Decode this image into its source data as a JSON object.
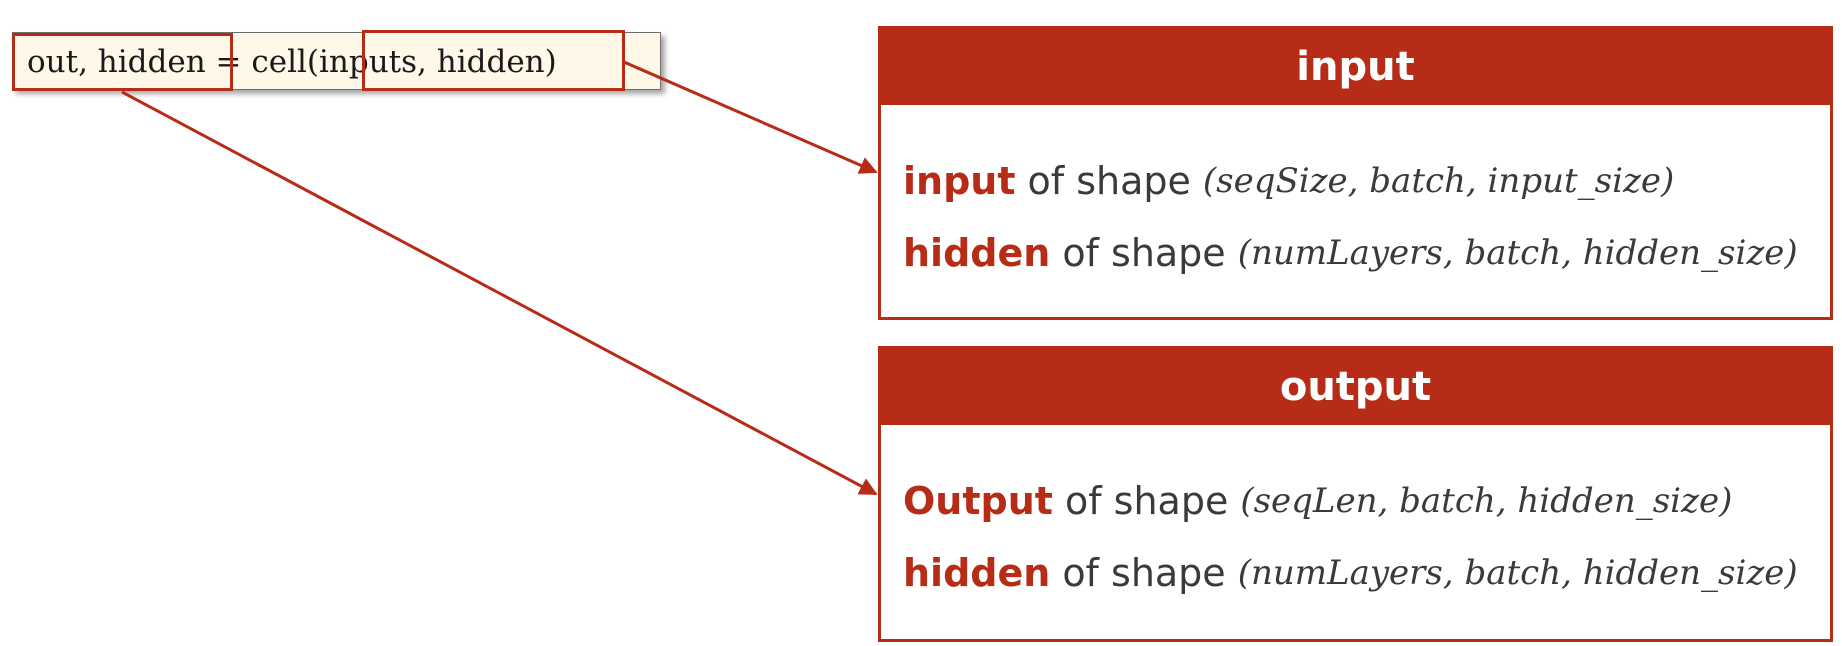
{
  "code": {
    "text": "out, hidden = cell(inputs, hidden)"
  },
  "input_panel": {
    "title": "input",
    "rows": [
      {
        "keyword": "input",
        "middle": "of shape",
        "shape": "(seqSize, batch, input_size)"
      },
      {
        "keyword": "hidden",
        "middle": "of shape",
        "shape": "(numLayers, batch, hidden_size)"
      }
    ]
  },
  "output_panel": {
    "title": "output",
    "rows": [
      {
        "keyword": "Output",
        "middle": "of shape",
        "shape": "(seqLen, batch, hidden_size)"
      },
      {
        "keyword": "hidden",
        "middle": "of shape",
        "shape": "(numLayers, batch, hidden_size)"
      }
    ]
  },
  "colors": {
    "accent": "#b72c16",
    "code_bg": "#fff8e8",
    "text": "#3a3a3a"
  }
}
